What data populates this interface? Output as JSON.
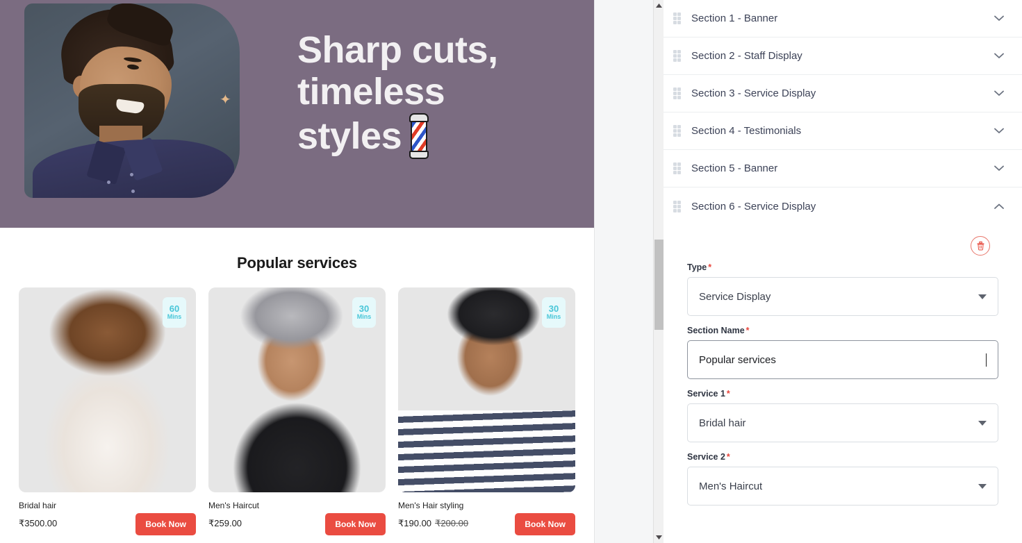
{
  "preview": {
    "banner": {
      "headline": "Sharp cuts, timeless styles",
      "headline_line1": "Sharp cuts,",
      "headline_line2": "timeless",
      "headline_line3": "styles",
      "bg_color": "#7b6c81",
      "sparkle": "✦",
      "barber_pole_icon": "barber-pole-icon"
    },
    "services_section": {
      "title": "Popular services",
      "cards": [
        {
          "name": "Bridal hair",
          "price": "₹3500.00",
          "old_price": "",
          "duration_value": "60",
          "duration_unit": "Mins",
          "button_label": "Book Now",
          "image_alt": "bridal-updo-photo"
        },
        {
          "name": "Men's Haircut",
          "price": "₹259.00",
          "old_price": "",
          "duration_value": "30",
          "duration_unit": "Mins",
          "button_label": "Book Now",
          "image_alt": "mens-haircut-photo"
        },
        {
          "name": "Men's Hair styling",
          "price": "₹190.00",
          "old_price": "₹200.00",
          "duration_value": "30",
          "duration_unit": "Mins",
          "button_label": "Book Now",
          "image_alt": "mens-hair-styling-photo"
        }
      ]
    }
  },
  "scrollbar": {
    "up_arrow_icon": "triangle-up-icon",
    "down_arrow_icon": "triangle-down-icon"
  },
  "editor": {
    "sections": [
      {
        "label": "Section 1 - Banner",
        "expanded": false,
        "chevron": "chevron-down-icon"
      },
      {
        "label": "Section 2 - Staff Display",
        "expanded": false,
        "chevron": "chevron-down-icon"
      },
      {
        "label": "Section 3 - Service Display",
        "expanded": false,
        "chevron": "chevron-down-icon"
      },
      {
        "label": "Section 4 - Testimonials",
        "expanded": false,
        "chevron": "chevron-down-icon"
      },
      {
        "label": "Section 5 - Banner",
        "expanded": false,
        "chevron": "chevron-down-icon"
      },
      {
        "label": "Section 6 - Service Display",
        "expanded": true,
        "chevron": "chevron-up-icon"
      }
    ],
    "expanded_form": {
      "delete_icon": "trash-icon",
      "fields": [
        {
          "label": "Type",
          "required": "*",
          "value": "Service Display",
          "kind": "select"
        },
        {
          "label": "Section Name",
          "required": "*",
          "value": "Popular services",
          "kind": "text",
          "focused": true
        },
        {
          "label": "Service 1",
          "required": "*",
          "value": "Bridal hair",
          "kind": "select"
        },
        {
          "label": "Service 2",
          "required": "*",
          "value": "Men's Haircut",
          "kind": "select"
        }
      ]
    }
  },
  "colors": {
    "accent_red": "#ea4c41",
    "banner_purple": "#7b6c81",
    "badge_cyan": "#48c6d8",
    "required_red": "#e8453c"
  }
}
